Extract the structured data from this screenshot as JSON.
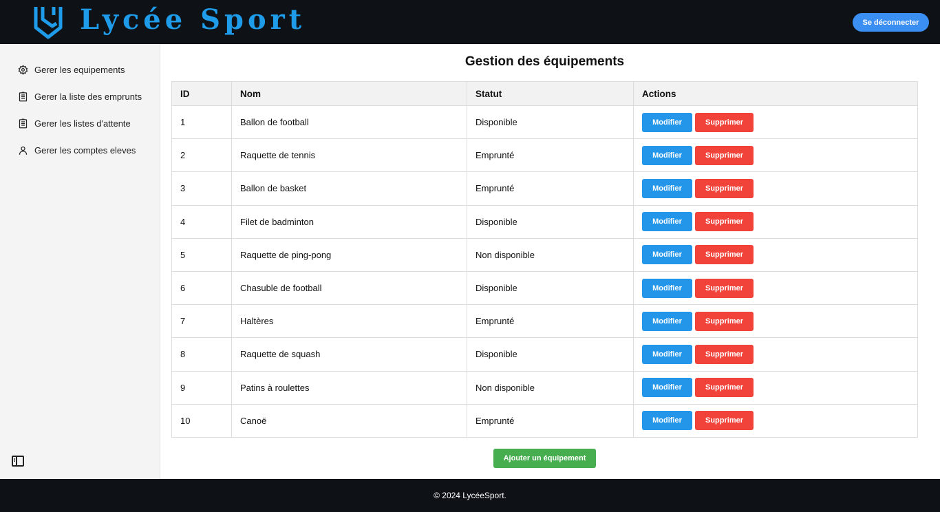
{
  "header": {
    "brand": "Lycée Sport",
    "logout_label": "Se déconnecter",
    "brand_color": "#1e9be9"
  },
  "sidebar": {
    "items": [
      {
        "label": "Gerer les equipements",
        "icon": "gear-icon"
      },
      {
        "label": "Gerer la liste des emprunts",
        "icon": "clipboard-list-icon"
      },
      {
        "label": "Gerer les listes d'attente",
        "icon": "clipboard-list-icon"
      },
      {
        "label": "Gerer les comptes eleves",
        "icon": "user-icon"
      }
    ],
    "toggle_icon": "sidebar-toggle-icon"
  },
  "main": {
    "title": "Gestion des équipements",
    "columns": [
      "ID",
      "Nom",
      "Statut",
      "Actions"
    ],
    "rows": [
      {
        "id": "1",
        "nom": "Ballon de football",
        "statut": "Disponible"
      },
      {
        "id": "2",
        "nom": "Raquette de tennis",
        "statut": "Emprunté"
      },
      {
        "id": "3",
        "nom": "Ballon de basket",
        "statut": "Emprunté"
      },
      {
        "id": "4",
        "nom": "Filet de badminton",
        "statut": "Disponible"
      },
      {
        "id": "5",
        "nom": "Raquette de ping-pong",
        "statut": "Non disponible"
      },
      {
        "id": "6",
        "nom": "Chasuble de football",
        "statut": "Disponible"
      },
      {
        "id": "7",
        "nom": "Haltères",
        "statut": "Emprunté"
      },
      {
        "id": "8",
        "nom": "Raquette de squash",
        "statut": "Disponible"
      },
      {
        "id": "9",
        "nom": "Patins à roulettes",
        "statut": "Non disponible"
      },
      {
        "id": "10",
        "nom": "Canoë",
        "statut": "Emprunté"
      }
    ],
    "edit_label": "Modifier",
    "delete_label": "Supprimer",
    "add_label": "Ajouter un équipement",
    "colors": {
      "edit": "#2396ea",
      "delete": "#f2433a",
      "add": "#46ae4f"
    }
  },
  "footer": {
    "text": "© 2024 LycéeSport."
  }
}
